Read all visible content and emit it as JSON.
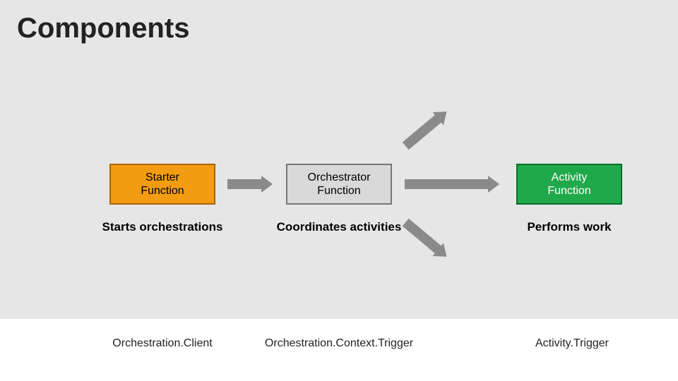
{
  "title": "Components",
  "boxes": {
    "starter": "Starter\nFunction",
    "orchestrator": "Orchestrator\nFunction",
    "activity": "Activity\nFunction"
  },
  "descriptions": {
    "starter": "Starts orchestrations",
    "orchestrator": "Coordinates activities",
    "activity": "Performs work"
  },
  "footer": {
    "starter": "Orchestration.Client",
    "orchestrator": "Orchestration.Context.Trigger",
    "activity": "Activity.Trigger"
  }
}
